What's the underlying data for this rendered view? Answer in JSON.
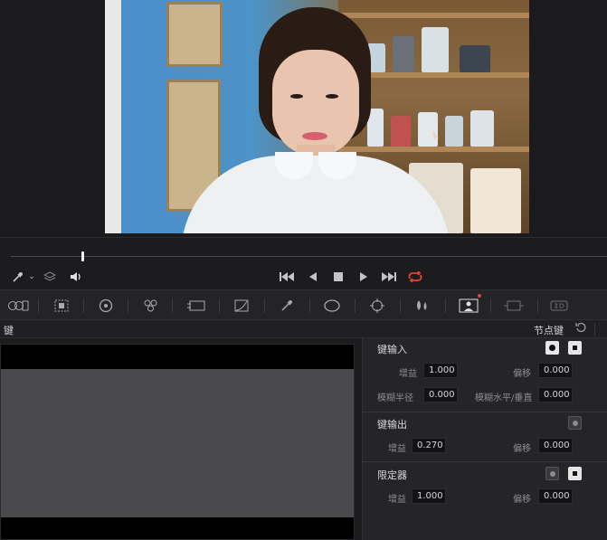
{
  "header": {
    "title": "键",
    "node_key": "节点键"
  },
  "transport": {
    "icons": [
      "eyedropper-icon",
      "chevron-down-icon",
      "layers-icon",
      "speaker-icon",
      "skip-back-icon",
      "play-reverse-icon",
      "stop-icon",
      "play-icon",
      "skip-forward-icon",
      "loop-icon"
    ]
  },
  "palette": {
    "icons": [
      "camera-raw-icon",
      "color-match-icon",
      "color-wheels-icon",
      "rgb-mixer-icon",
      "motion-effects-icon",
      "curves-icon",
      "qualifier-icon",
      "window-icon",
      "tracker-icon",
      "blur-icon",
      "key-icon",
      "sizing-icon",
      "3d-icon"
    ]
  },
  "key_input": {
    "title": "键输入",
    "gain_label": "增益",
    "gain_value": "1.000",
    "offset_label": "偏移",
    "offset_value": "0.000",
    "blur_radius_label": "模糊半径",
    "blur_radius_value": "0.000",
    "blur_hv_label": "模糊水平/垂直",
    "blur_hv_value": "0.000"
  },
  "key_output": {
    "title": "键输出",
    "gain_label": "增益",
    "gain_value": "0.270",
    "offset_label": "偏移",
    "offset_value": "0.000"
  },
  "qualifier": {
    "title": "限定器",
    "gain_label": "增益",
    "gain_value": "1.000",
    "offset_label": "偏移",
    "offset_value": "0.000"
  },
  "colors": {
    "loop_accent": "#e2453a",
    "panel_bg": "#252528",
    "field_bg": "#121214"
  }
}
